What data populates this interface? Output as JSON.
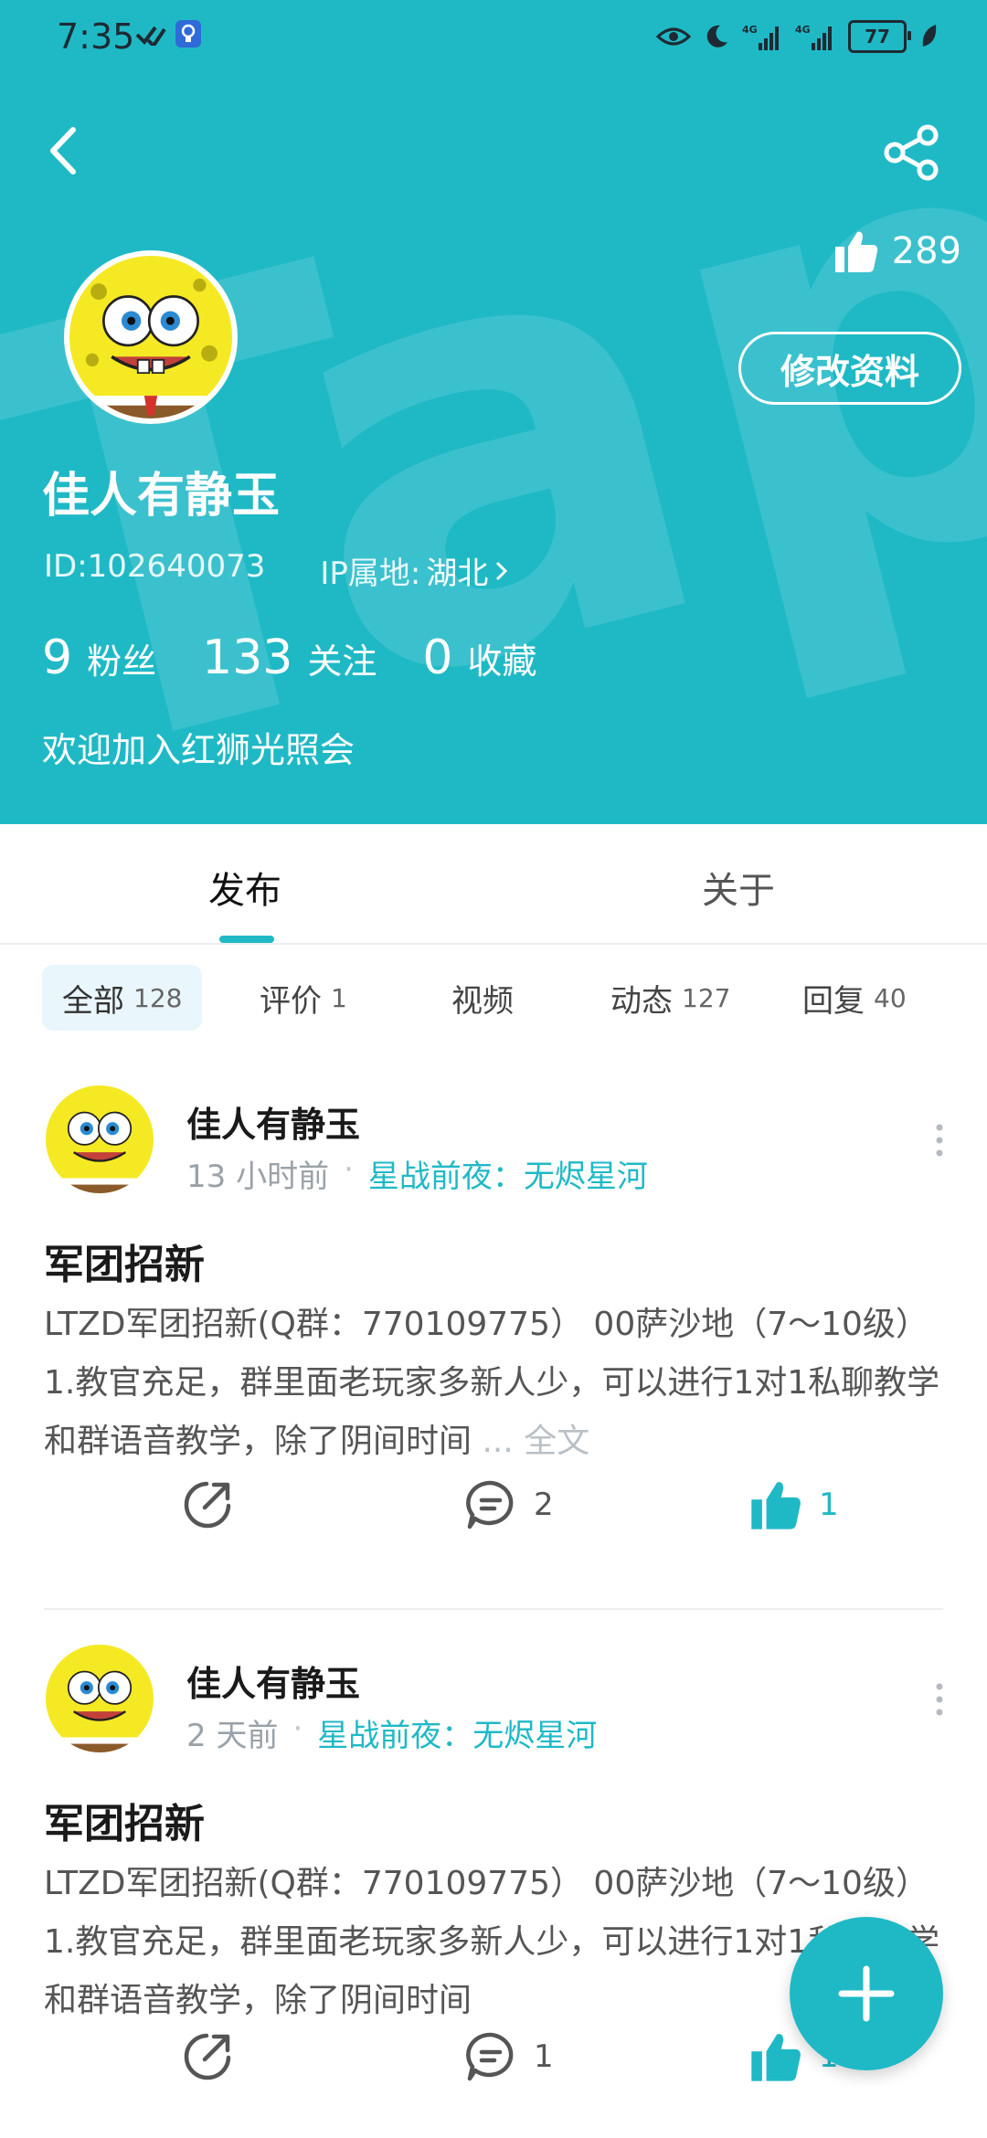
{
  "status_bar": {
    "time": "7:35",
    "battery": "77",
    "icons": [
      "signal-check-icon",
      "bulb-notification-icon",
      "eye-icon",
      "moon-icon",
      "4g-signal-icon",
      "4g-signal-icon",
      "battery-icon",
      "leaf-icon"
    ]
  },
  "header": {
    "likes_count": "289",
    "edit_button": "修改资料",
    "username": "佳人有静玉",
    "user_id": "ID:102640073",
    "ip_label": "IP属地:",
    "ip_value": "湖北",
    "stats": [
      {
        "num": "9",
        "label": "粉丝"
      },
      {
        "num": "133",
        "label": "关注"
      },
      {
        "num": "0",
        "label": "收藏"
      }
    ],
    "bio": "欢迎加入红狮光照会",
    "colors": {
      "accent": "#1fb9c6"
    }
  },
  "tabs": [
    "发布",
    "关于"
  ],
  "filters": [
    {
      "label": "全部",
      "count": "128"
    },
    {
      "label": "评价",
      "count": "1"
    },
    {
      "label": "视频",
      "count": ""
    },
    {
      "label": "动态",
      "count": "127"
    },
    {
      "label": "回复",
      "count": "40"
    }
  ],
  "posts": [
    {
      "user": "佳人有静玉",
      "time": "13 小时前",
      "game": "星战前夜：无烬星河",
      "title": "军团招新",
      "body": "LTZD军团招新(Q群：770109775） 00萨沙地（7～10级）1.教官充足，群里面老玩家多新人少，可以进行1对1私聊教学和群语音教学，除了阴间时间",
      "read_more": "... 全文",
      "comments": "2",
      "likes": "1"
    },
    {
      "user": "佳人有静玉",
      "time": "2 天前",
      "game": "星战前夜：无烬星河",
      "title": "军团招新",
      "body": "LTZD军团招新(Q群：770109775） 00萨沙地（7～10级）1.教官充足，群里面老玩家多新人少，可以进行1对1私聊教学和群语音教学，除了阴间时间",
      "read_more": "",
      "comments": "1",
      "likes": "1"
    }
  ]
}
